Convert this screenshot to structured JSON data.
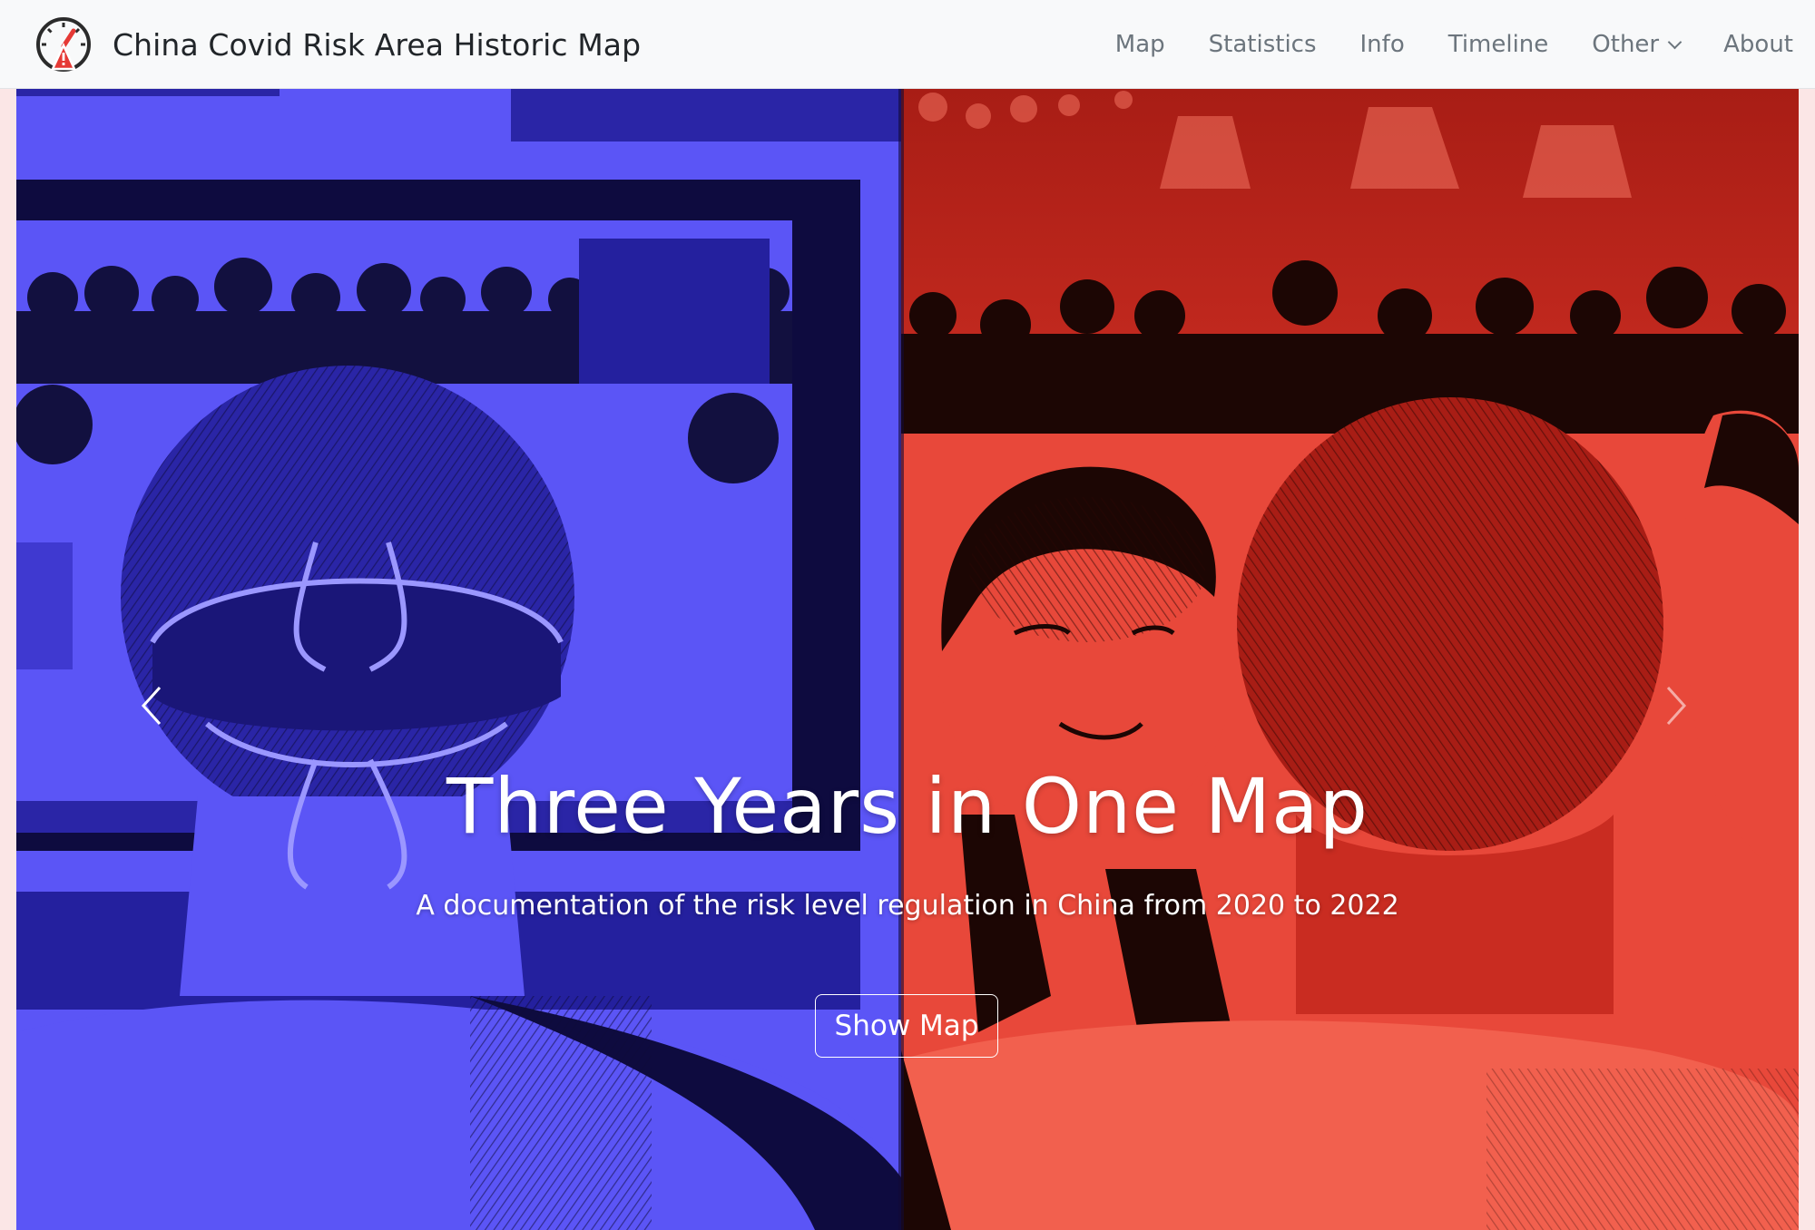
{
  "header": {
    "brand_title": "China Covid Risk Area Historic Map",
    "logo_icon": "speedometer-warning-icon",
    "nav_items": [
      {
        "label": "Map"
      },
      {
        "label": "Statistics"
      },
      {
        "label": "Info"
      },
      {
        "label": "Timeline"
      },
      {
        "label": "Other",
        "dropdown": true
      },
      {
        "label": "About"
      }
    ]
  },
  "hero": {
    "title": "Three Years in One Map",
    "subtitle": "A documentation of the risk level regulation in China from 2020 to 2022",
    "cta_label": "Show Map",
    "prev_icon": "chevron-left-icon",
    "next_icon": "chevron-right-icon"
  },
  "colors": {
    "navbar_bg": "#f8f9fa",
    "nav_link": "#6c757d",
    "brand_text": "#212529",
    "hero_blue": "#5b55f6",
    "hero_blue_dark": "#1b1770",
    "hero_red": "#e8483a",
    "hero_red_dark": "#8a1610",
    "logo_red": "#e53935"
  }
}
